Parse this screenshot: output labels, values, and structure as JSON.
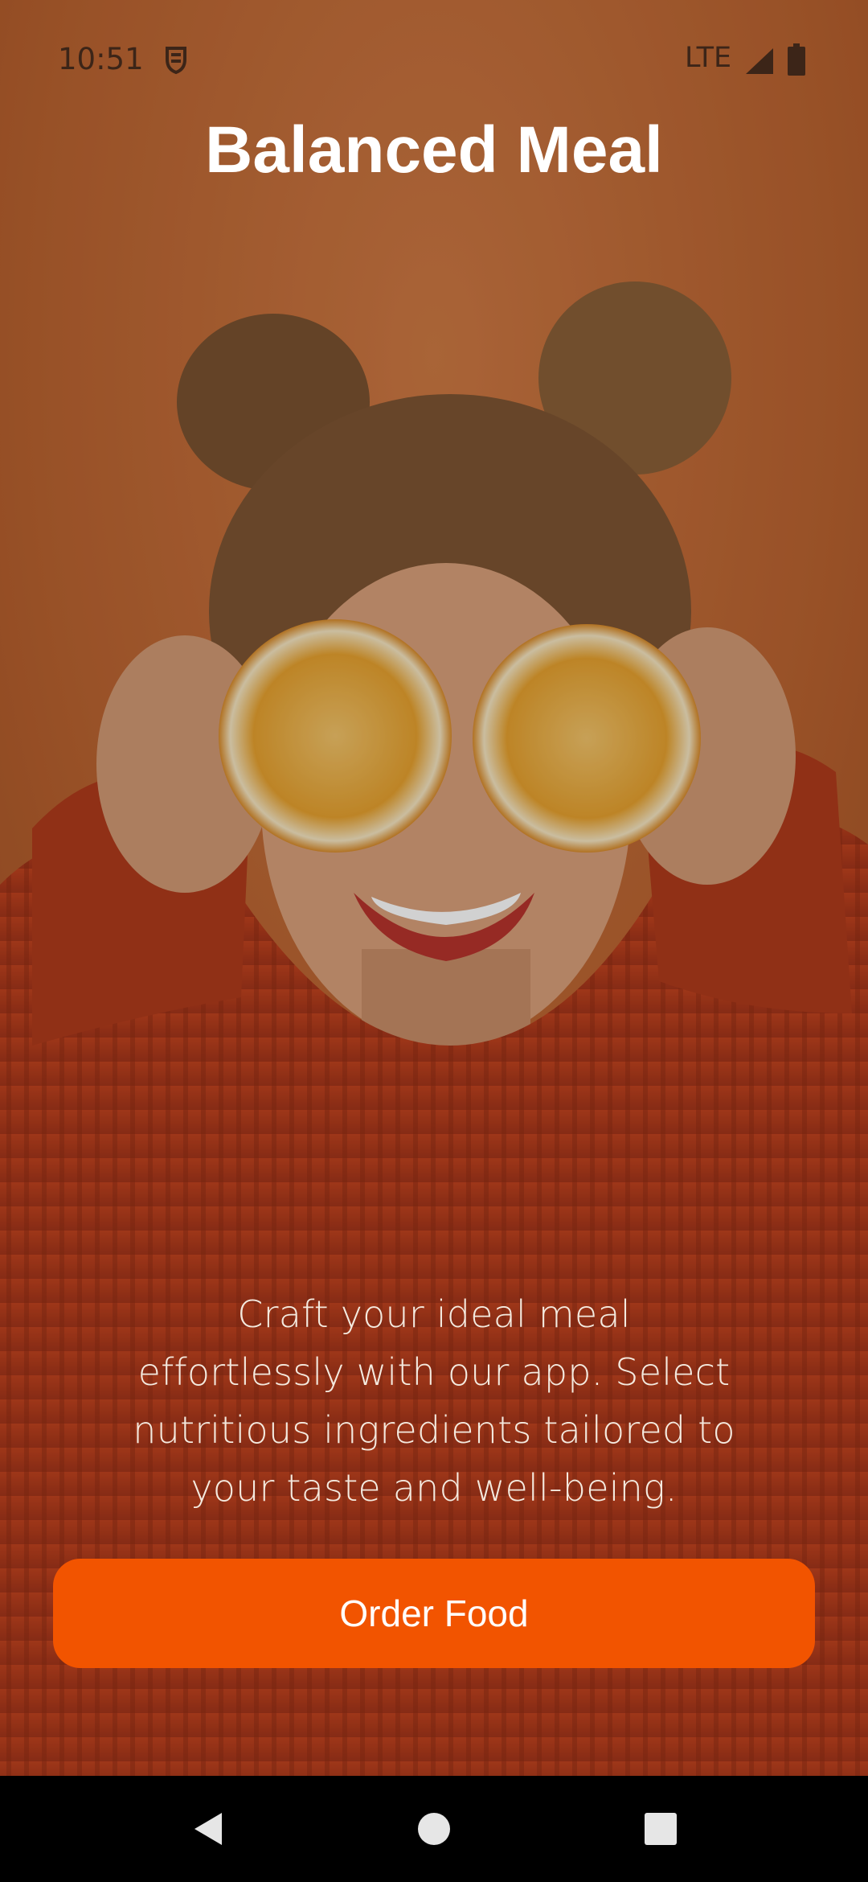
{
  "status_bar": {
    "time": "10:51",
    "network": "LTE",
    "icons": [
      "notification-icon",
      "signal-icon",
      "battery-icon"
    ]
  },
  "app": {
    "title": "Balanced Meal",
    "description": "Craft your ideal meal effortlessly with our app. Select nutritious ingredients tailored to your taste and well-being.",
    "cta_label": "Order Food"
  },
  "nav_bar": {
    "icons": [
      "back-icon",
      "home-icon",
      "recents-icon"
    ]
  },
  "colors": {
    "accent": "#f25400",
    "background": "#b0582c",
    "title_text": "#ffffff"
  }
}
